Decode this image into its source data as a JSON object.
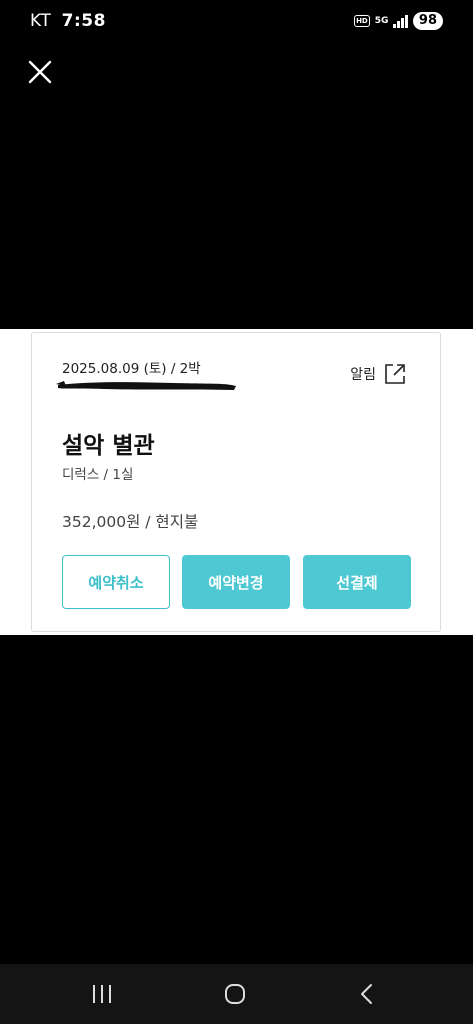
{
  "status_bar": {
    "carrier": "KT",
    "time": "7:58",
    "hd_label": "HD",
    "network_label": "5G",
    "battery": "98",
    "icons": [
      "hd-voice-icon",
      "5g-icon",
      "signal-icon",
      "battery-icon"
    ]
  },
  "header": {
    "close_icon": "close-icon"
  },
  "reservation": {
    "date": "2025.08.09 (토) / 2박",
    "alarm_label": "알림",
    "alarm_icon": "external-link-icon",
    "hotel_name": "설악 별관",
    "room": "디럭스 / 1실",
    "price": "352,000원 / 현지불",
    "buttons": {
      "cancel": "예약취소",
      "change": "예약변경",
      "prepay": "선결제"
    },
    "colors": {
      "accent": "#4ec9d3",
      "accent_border": "#3dbfc9"
    }
  },
  "nav_bar": {
    "icons": [
      "recent-apps-icon",
      "home-icon",
      "back-icon"
    ]
  }
}
